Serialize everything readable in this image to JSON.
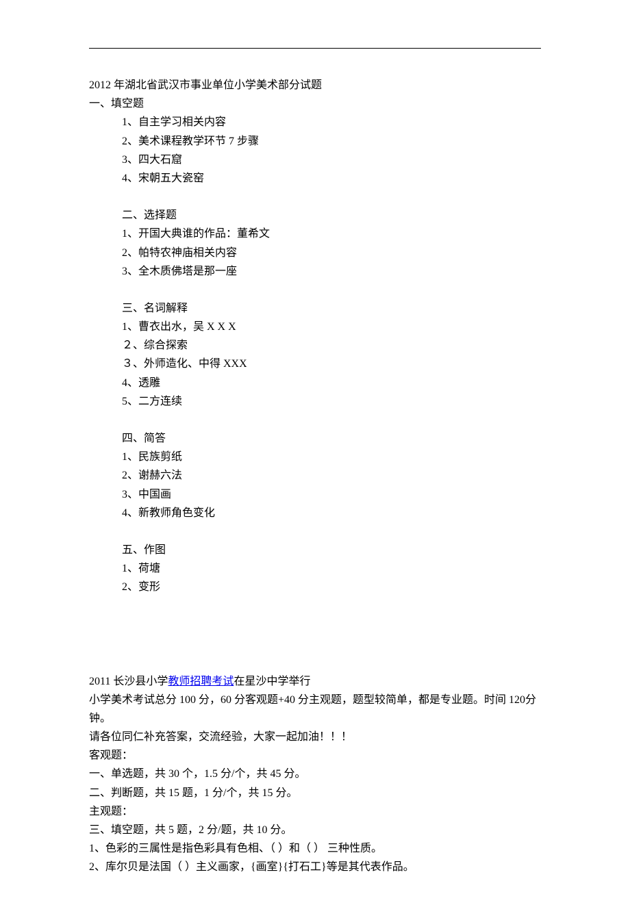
{
  "doc1": {
    "title": "2012 年湖北省武汉市事业单位小学美术部分试题",
    "s1": {
      "heading": "一、填空题",
      "i1": "1、自主学习相关内容",
      "i2": "2、美术课程教学环节 7 步骤",
      "i3": "3、四大石窟",
      "i4": "4、宋朝五大瓷窑"
    },
    "s2": {
      "heading": "二、选择题",
      "i1": "1、开国大典谁的作品：董希文",
      "i2": "2、帕特农神庙相关内容",
      "i3": "3、全木质佛塔是那一座"
    },
    "s3": {
      "heading": "三、名词解释",
      "i1": "1、曹衣出水，吴 X X X",
      "i2": "２、综合探索",
      "i3": "３、外师造化、中得 XXX",
      "i4": "4、透雕",
      "i5": "5、二方连续"
    },
    "s4": {
      "heading": "四、简答",
      "i1": "1、民族剪纸",
      "i2": "2、谢赫六法",
      "i3": "3、中国画",
      "i4": "4、新教师角色变化"
    },
    "s5": {
      "heading": "五、作图",
      "i1": "1、荷塘",
      "i2": "2、变形"
    }
  },
  "doc2": {
    "line1_pre": "2011 长沙县小学",
    "line1_link": "教师招聘考试",
    "line1_post": "在星沙中学举行",
    "p1": "小学美术考试总分 100 分，60 分客观题+40 分主观题，题型较简单，都是专业题。时间 120分钟。",
    "p2": "请各位同仁补充答案，交流经验，大家一起加油！！！",
    "h_obj": "客观题：",
    "obj1": "一、单选题，共 30 个，1.5 分/个，共 45 分。",
    "obj2": "二、判断题，共 15 题，1 分/个，共 15 分。",
    "h_sub": "主观题：",
    "sub_h": "三、填空题，共 5 题，2 分/题，共 10 分。",
    "sub1": "1、色彩的三属性是指色彩具有色相、（ ）和（ ） 三种性质。",
    "sub2": "2、库尔贝是法国（ ）主义画家，{画室}{打石工}等是其代表作品。"
  }
}
